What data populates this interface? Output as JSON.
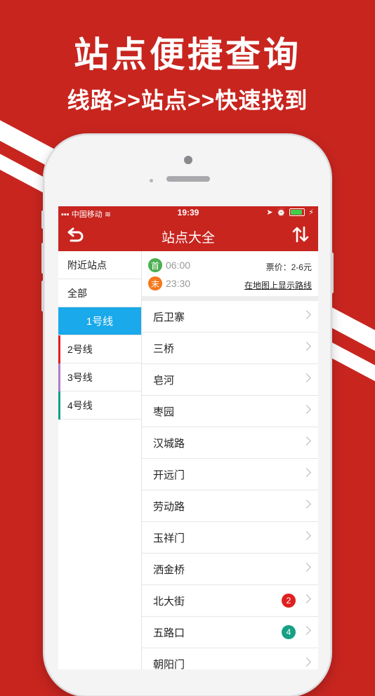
{
  "banner": {
    "headline": "站点便捷查询",
    "subline": "线路>>站点>>快速找到"
  },
  "status_bar": {
    "carrier": "中国移动",
    "time": "19:39"
  },
  "nav": {
    "title": "站点大全"
  },
  "sidebar": {
    "items": [
      {
        "label": "附近站点",
        "active": false,
        "color": ""
      },
      {
        "label": "全部",
        "active": false,
        "color": ""
      },
      {
        "label": "1号线",
        "active": true,
        "color": "#1aa9ea"
      },
      {
        "label": "2号线",
        "active": false,
        "color": "#e02020"
      },
      {
        "label": "3号线",
        "active": false,
        "color": "#b07cc6"
      },
      {
        "label": "4号线",
        "active": false,
        "color": "#16a085"
      }
    ]
  },
  "info": {
    "first_label": "首",
    "first_time": "06:00",
    "last_label": "末",
    "last_time": "23:30",
    "price": "票价：2-6元",
    "map_link": "在地图上显示路线"
  },
  "stations": [
    {
      "name": "后卫寨",
      "badge": ""
    },
    {
      "name": "三桥",
      "badge": ""
    },
    {
      "name": "皂河",
      "badge": ""
    },
    {
      "name": "枣园",
      "badge": ""
    },
    {
      "name": "汉城路",
      "badge": ""
    },
    {
      "name": "开远门",
      "badge": ""
    },
    {
      "name": "劳动路",
      "badge": ""
    },
    {
      "name": "玉祥门",
      "badge": ""
    },
    {
      "name": "洒金桥",
      "badge": ""
    },
    {
      "name": "北大街",
      "badge": "2"
    },
    {
      "name": "五路口",
      "badge": "4"
    },
    {
      "name": "朝阳门",
      "badge": ""
    }
  ],
  "colors": {
    "brand_red": "#c8251f",
    "active_blue": "#1aa9ea",
    "first_green": "#4caf50",
    "last_orange": "#f5761a",
    "badge_line2": "#e02020",
    "badge_line4": "#16a085"
  }
}
